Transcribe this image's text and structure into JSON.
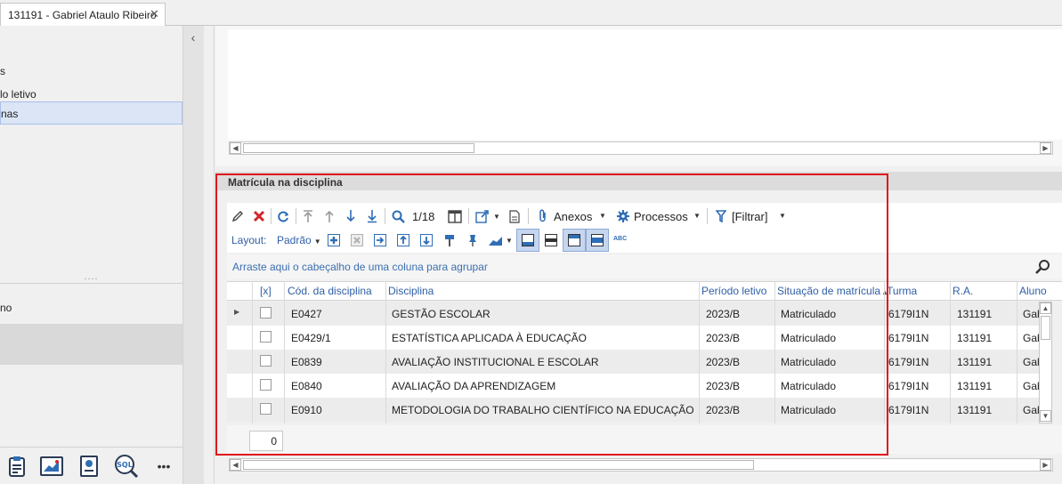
{
  "tab": {
    "title": "131191 - Gabriel Ataulo Ribeiro",
    "close": "✕"
  },
  "sidebar": {
    "items": [
      {
        "label": "s"
      },
      {
        "label": "lo letivo"
      },
      {
        "label": "nas"
      }
    ],
    "grip": "....",
    "lower_item": "no"
  },
  "bottom_icons": [
    "clipboard-icon",
    "chart-icon",
    "certificate-icon",
    "sql-icon",
    "more-icon"
  ],
  "bottom_sql": "SQL",
  "bottom_more": "•••",
  "section": {
    "title": "Matrícula na disciplina"
  },
  "toolbar": {
    "page_counter": "1/18",
    "attachments": "Anexos",
    "processes": "Processos",
    "filter": "[Filtrar]",
    "layout_label": "Layout:",
    "layout_value": "Padrão",
    "abc": "ABC"
  },
  "grid": {
    "group_hint": "Arraste aqui o cabeçalho de uma coluna para agrupar",
    "columns": {
      "select": "[x]",
      "code": "Cód. da disciplina",
      "discipline": "Disciplina",
      "period": "Período letivo",
      "status": "Situação de matrícula",
      "class": "Turma",
      "ra": "R.A.",
      "student": "Aluno"
    },
    "rows": [
      {
        "code": "E0427",
        "discipline": "GESTÃO ESCOLAR",
        "period": "2023/B",
        "status": "Matriculado",
        "class": "6179I1N",
        "ra": "131191",
        "student": "Gab"
      },
      {
        "code": "E0429/1",
        "discipline": "ESTATÍSTICA APLICADA À EDUCAÇÃO",
        "period": "2023/B",
        "status": "Matriculado",
        "class": "6179I1N",
        "ra": "131191",
        "student": "Gab"
      },
      {
        "code": "E0839",
        "discipline": "AVALIAÇÃO INSTITUCIONAL E ESCOLAR",
        "period": "2023/B",
        "status": "Matriculado",
        "class": "6179I1N",
        "ra": "131191",
        "student": "Gab"
      },
      {
        "code": "E0840",
        "discipline": "AVALIAÇÃO DA APRENDIZAGEM",
        "period": "2023/B",
        "status": "Matriculado",
        "class": "6179I1N",
        "ra": "131191",
        "student": "Gab"
      },
      {
        "code": "E0910",
        "discipline": "METODOLOGIA DO TRABALHO CIENTÍFICO NA EDUCAÇÃO",
        "period": "2023/B",
        "status": "Matriculado",
        "class": "6179I1N",
        "ra": "131191",
        "student": "Gab"
      }
    ],
    "selected_count": "0"
  },
  "colors": {
    "highlight": "#e0151b",
    "header_text": "#2f5fa6",
    "hint_text": "#3b6fb0",
    "delete": "#d0262b",
    "accent_blue": "#2f6db5"
  }
}
